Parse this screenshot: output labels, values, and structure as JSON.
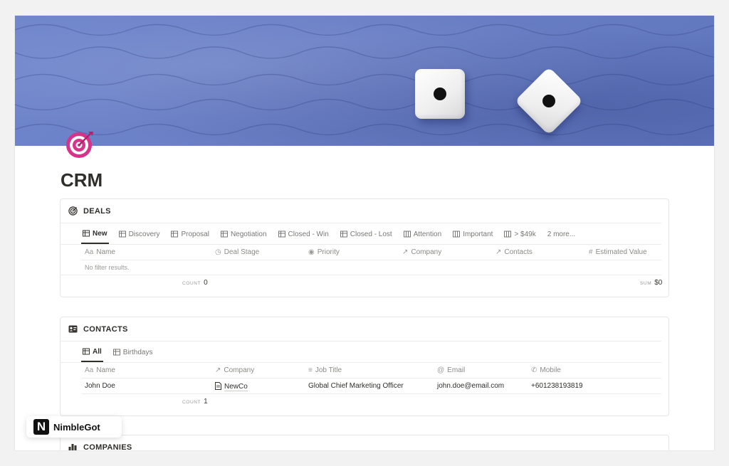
{
  "page": {
    "title": "CRM"
  },
  "deals": {
    "title": "DEALS",
    "tabs": [
      "New",
      "Discovery",
      "Proposal",
      "Negotiation",
      "Closed - Win",
      "Closed - Lost",
      "Attention",
      "Important",
      "> $49k",
      "2 more..."
    ],
    "columns": [
      "Name",
      "Deal Stage",
      "Priority",
      "Company",
      "Contacts",
      "Estimated Value"
    ],
    "empty_text": "No filter results.",
    "count_label": "COUNT",
    "count_value": "0",
    "sum_label": "SUM",
    "sum_value": "$0"
  },
  "contacts": {
    "title": "CONTACTS",
    "tabs": [
      "All",
      "Birthdays"
    ],
    "columns": [
      "Name",
      "Company",
      "Job Title",
      "Email",
      "Mobile"
    ],
    "rows": [
      {
        "name": "John Doe",
        "company": "NewCo",
        "job_title": "Global Chief Marketing Officer",
        "email": "john.doe@email.com",
        "mobile": "+601238193819"
      }
    ],
    "count_label": "COUNT",
    "count_value": "1"
  },
  "companies": {
    "title": "COMPANIES"
  },
  "badge": {
    "logo_letter": "N",
    "name": "NimbleGot"
  },
  "icons": {
    "page": "target-icon",
    "deals": "target-icon",
    "contacts": "contact-card-icon",
    "companies": "bar-chart-icon"
  },
  "colors": {
    "page_icon": "#d6338a",
    "cover": "#6b80c6"
  }
}
